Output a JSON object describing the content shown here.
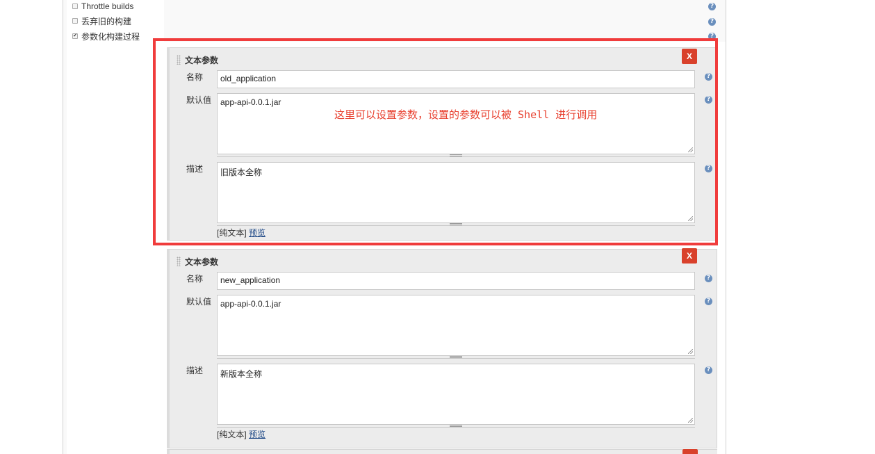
{
  "options": [
    {
      "label": "Throttle builds",
      "checked": false
    },
    {
      "label": "丢弃旧的构建",
      "checked": false
    },
    {
      "label": "参数化构建过程",
      "checked": true
    }
  ],
  "help_glyph": "?",
  "parameters": [
    {
      "title": "文本参数",
      "delete_label": "X",
      "name_label": "名称",
      "name_value": "old_application",
      "default_label": "默认值",
      "default_value": "app-api-0.0.1.jar",
      "desc_label": "描述",
      "desc_value": "旧版本全称",
      "format_plain": "[纯文本]",
      "format_preview": "预览"
    },
    {
      "title": "文本参数",
      "delete_label": "X",
      "name_label": "名称",
      "name_value": "new_application",
      "default_label": "默认值",
      "default_value": "app-api-0.0.1.jar",
      "desc_label": "描述",
      "desc_value": "新版本全称",
      "format_plain": "[纯文本]",
      "format_preview": "预览"
    }
  ],
  "annotation": {
    "text": "这里可以设置参数，设置的参数可以被 Shell 进行调用",
    "color": "#e8402f"
  },
  "colors": {
    "delete_button": "#d9412b",
    "help_icon": "#6a8fbd",
    "panel_bg": "#ececec",
    "link": "#204a87"
  }
}
